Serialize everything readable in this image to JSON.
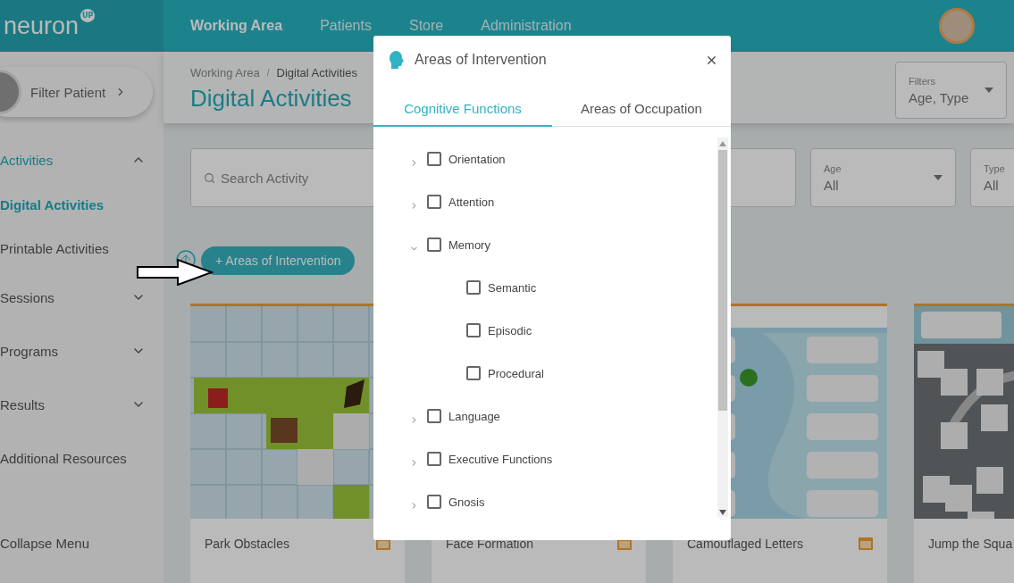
{
  "header": {
    "logo": {
      "text": "neuron",
      "badge": "UP"
    },
    "nav": [
      {
        "label": "Working Area",
        "selected": true
      },
      {
        "label": "Patients",
        "selected": false
      },
      {
        "label": "Store",
        "selected": false
      },
      {
        "label": "Administration",
        "selected": false
      }
    ]
  },
  "sidebar": {
    "filter_patient": "Filter Patient",
    "menu": [
      {
        "label": "Activities",
        "selected": true,
        "expanded": true,
        "children": [
          {
            "label": "Digital Activities",
            "selected": true
          },
          {
            "label": "Printable Activities",
            "selected": false
          }
        ]
      },
      {
        "label": "Sessions",
        "selected": false,
        "expanded": false
      },
      {
        "label": "Programs",
        "selected": false,
        "expanded": false
      },
      {
        "label": "Results",
        "selected": false,
        "expanded": false
      },
      {
        "label": "Additional Resources",
        "selected": false
      }
    ],
    "collapse_menu": "Collapse Menu"
  },
  "page": {
    "breadcrumb": [
      "Working Area",
      "Digital Activities"
    ],
    "breadcrumb_separator": "/",
    "title": "Digital Activities",
    "filters": {
      "label": "Filters",
      "value": "Age, Type"
    }
  },
  "toolbar": {
    "search": {
      "placeholder": "Search Activity"
    },
    "selects": [
      {
        "label": "Age",
        "value": "All"
      },
      {
        "label": "Type",
        "value": "All"
      }
    ],
    "areas_button": "+ Areas of Intervention"
  },
  "activities": [
    {
      "title": "Park Obstacles",
      "kind": "grid"
    },
    {
      "title": "Face Formation",
      "kind": "hidden"
    },
    {
      "title": "Camouflaged Letters",
      "kind": "words"
    },
    {
      "title": "Jump the Squa",
      "kind": "road"
    }
  ],
  "modal": {
    "title": "Areas of Intervention",
    "tabs": [
      {
        "label": "Cognitive Functions",
        "selected": true
      },
      {
        "label": "Areas of Occupation",
        "selected": false
      }
    ],
    "tree": [
      {
        "label": "Orientation",
        "checked": false,
        "expanded": false
      },
      {
        "label": "Attention",
        "checked": false,
        "expanded": false
      },
      {
        "label": "Memory",
        "checked": false,
        "expanded": true,
        "children": [
          {
            "label": "Semantic",
            "checked": false
          },
          {
            "label": "Episodic",
            "checked": false
          },
          {
            "label": "Procedural",
            "checked": false
          }
        ]
      },
      {
        "label": "Language",
        "checked": false,
        "expanded": false
      },
      {
        "label": "Executive Functions",
        "checked": false,
        "expanded": false
      },
      {
        "label": "Gnosis",
        "checked": false,
        "expanded": false
      }
    ]
  }
}
